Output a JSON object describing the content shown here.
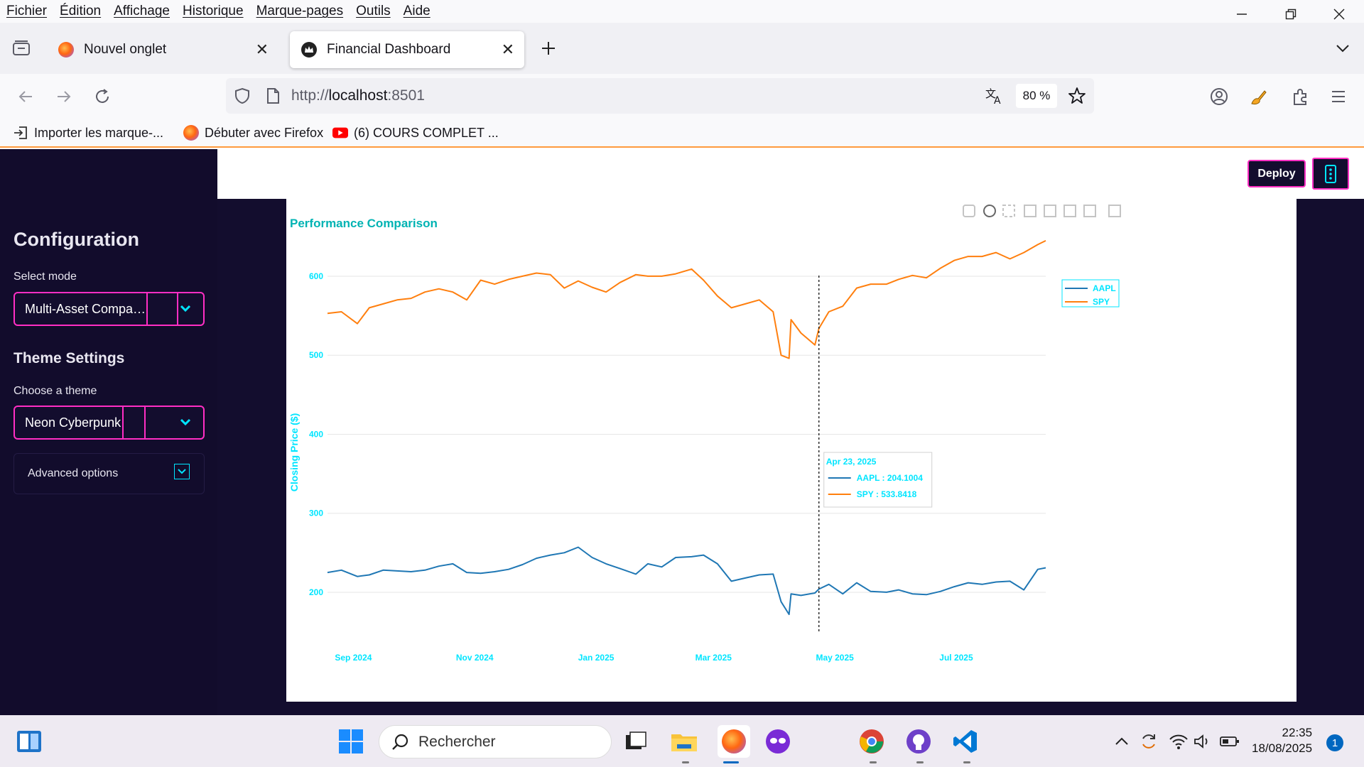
{
  "menubar": {
    "items": [
      "Fichier",
      "Édition",
      "Affichage",
      "Historique",
      "Marque-pages",
      "Outils",
      "Aide"
    ]
  },
  "tabs": [
    {
      "label": "Nouvel onglet",
      "active": false
    },
    {
      "label": "Financial Dashboard",
      "active": true
    }
  ],
  "navbar": {
    "url_prefix": "http://",
    "url_host": "localhost",
    "url_suffix": ":8501",
    "zoom": "80 %"
  },
  "bookmarks": [
    {
      "label": "Importer les marque-...",
      "icon": "import-icon"
    },
    {
      "label": "Débuter avec Firefox",
      "icon": "firefox-icon"
    },
    {
      "label": "(6) COURS COMPLET ...",
      "icon": "youtube-icon"
    }
  ],
  "header": {
    "deploy_label": "Deploy"
  },
  "sidebar": {
    "title": "Configuration",
    "mode_label": "Select mode",
    "mode_value": "Multi-Asset Compa…",
    "theme_heading": "Theme Settings",
    "theme_label": "Choose a theme",
    "theme_value": "Neon Cyberpunk",
    "advanced_label": "Advanced options"
  },
  "colors": {
    "accent_pink": "#ff2ec4",
    "accent_cyan": "#00e5ff",
    "chart_title": "#00b3b3",
    "aapl": "#1f77b4",
    "spy": "#ff7f0e",
    "sidebar_bg": "#120c2c"
  },
  "chart_data": {
    "type": "line",
    "title": "Performance Comparison",
    "xlabel": "",
    "ylabel": "Closing Price ($)",
    "ylim": [
      155,
      635
    ],
    "y_ticks": [
      200,
      300,
      400,
      500,
      600
    ],
    "x_ticks": [
      "Sep 2024",
      "Nov 2024",
      "Jan 2025",
      "Mar 2025",
      "May 2025",
      "Jul 2025"
    ],
    "legend": [
      "AAPL",
      "SPY"
    ],
    "legend_position": "top-right",
    "grid": true,
    "series": [
      {
        "name": "AAPL",
        "x": [
          "2024-08-19",
          "2024-08-26",
          "2024-09-03",
          "2024-09-09",
          "2024-09-16",
          "2024-09-23",
          "2024-09-30",
          "2024-10-07",
          "2024-10-14",
          "2024-10-21",
          "2024-10-28",
          "2024-11-04",
          "2024-11-11",
          "2024-11-18",
          "2024-11-25",
          "2024-12-02",
          "2024-12-09",
          "2024-12-16",
          "2024-12-23",
          "2024-12-30",
          "2025-01-06",
          "2025-01-13",
          "2025-01-21",
          "2025-01-27",
          "2025-02-03",
          "2025-02-10",
          "2025-02-18",
          "2025-02-24",
          "2025-03-03",
          "2025-03-10",
          "2025-03-17",
          "2025-03-24",
          "2025-03-31",
          "2025-04-04",
          "2025-04-08",
          "2025-04-09",
          "2025-04-14",
          "2025-04-21",
          "2025-04-23",
          "2025-04-28",
          "2025-05-05",
          "2025-05-12",
          "2025-05-19",
          "2025-05-27",
          "2025-06-02",
          "2025-06-09",
          "2025-06-16",
          "2025-06-23",
          "2025-06-30",
          "2025-07-07",
          "2025-07-14",
          "2025-07-21",
          "2025-07-28",
          "2025-08-04",
          "2025-08-11",
          "2025-08-15"
        ],
        "values": [
          225,
          228,
          220,
          222,
          228,
          227,
          226,
          228,
          233,
          236,
          225,
          224,
          226,
          229,
          235,
          243,
          247,
          250,
          257,
          244,
          236,
          230,
          223,
          236,
          232,
          244,
          245,
          247,
          236,
          214,
          218,
          222,
          223,
          188,
          172,
          198,
          196,
          199,
          204,
          210,
          198,
          212,
          201,
          200,
          203,
          198,
          197,
          201,
          207,
          212,
          210,
          213,
          214,
          203,
          229,
          231
        ]
      },
      {
        "name": "SPY",
        "x": [
          "2024-08-19",
          "2024-08-26",
          "2024-09-03",
          "2024-09-09",
          "2024-09-16",
          "2024-09-23",
          "2024-09-30",
          "2024-10-07",
          "2024-10-14",
          "2024-10-21",
          "2024-10-28",
          "2024-11-04",
          "2024-11-11",
          "2024-11-18",
          "2024-11-25",
          "2024-12-02",
          "2024-12-09",
          "2024-12-16",
          "2024-12-23",
          "2024-12-30",
          "2025-01-06",
          "2025-01-13",
          "2025-01-21",
          "2025-01-27",
          "2025-02-03",
          "2025-02-10",
          "2025-02-18",
          "2025-02-24",
          "2025-03-03",
          "2025-03-10",
          "2025-03-17",
          "2025-03-24",
          "2025-03-31",
          "2025-04-04",
          "2025-04-08",
          "2025-04-09",
          "2025-04-14",
          "2025-04-21",
          "2025-04-23",
          "2025-04-28",
          "2025-05-05",
          "2025-05-12",
          "2025-05-19",
          "2025-05-27",
          "2025-06-02",
          "2025-06-09",
          "2025-06-16",
          "2025-06-23",
          "2025-06-30",
          "2025-07-07",
          "2025-07-14",
          "2025-07-21",
          "2025-07-28",
          "2025-08-04",
          "2025-08-11",
          "2025-08-15"
        ],
        "values": [
          553,
          555,
          540,
          560,
          565,
          570,
          572,
          580,
          584,
          580,
          570,
          595,
          590,
          596,
          600,
          604,
          602,
          585,
          594,
          586,
          580,
          592,
          602,
          600,
          600,
          603,
          609,
          595,
          575,
          560,
          565,
          570,
          555,
          500,
          496,
          545,
          528,
          513,
          533.84,
          555,
          562,
          585,
          590,
          590,
          596,
          601,
          598,
          610,
          620,
          625,
          625,
          630,
          622,
          630,
          640,
          645
        ]
      }
    ],
    "hover": {
      "date": "Apr 23, 2025",
      "items": [
        "AAPL : 204.1004",
        "SPY : 533.8418"
      ]
    }
  },
  "taskbar": {
    "search_placeholder": "Rechercher",
    "time": "22:35",
    "date": "18/08/2025",
    "notifications": "1"
  }
}
